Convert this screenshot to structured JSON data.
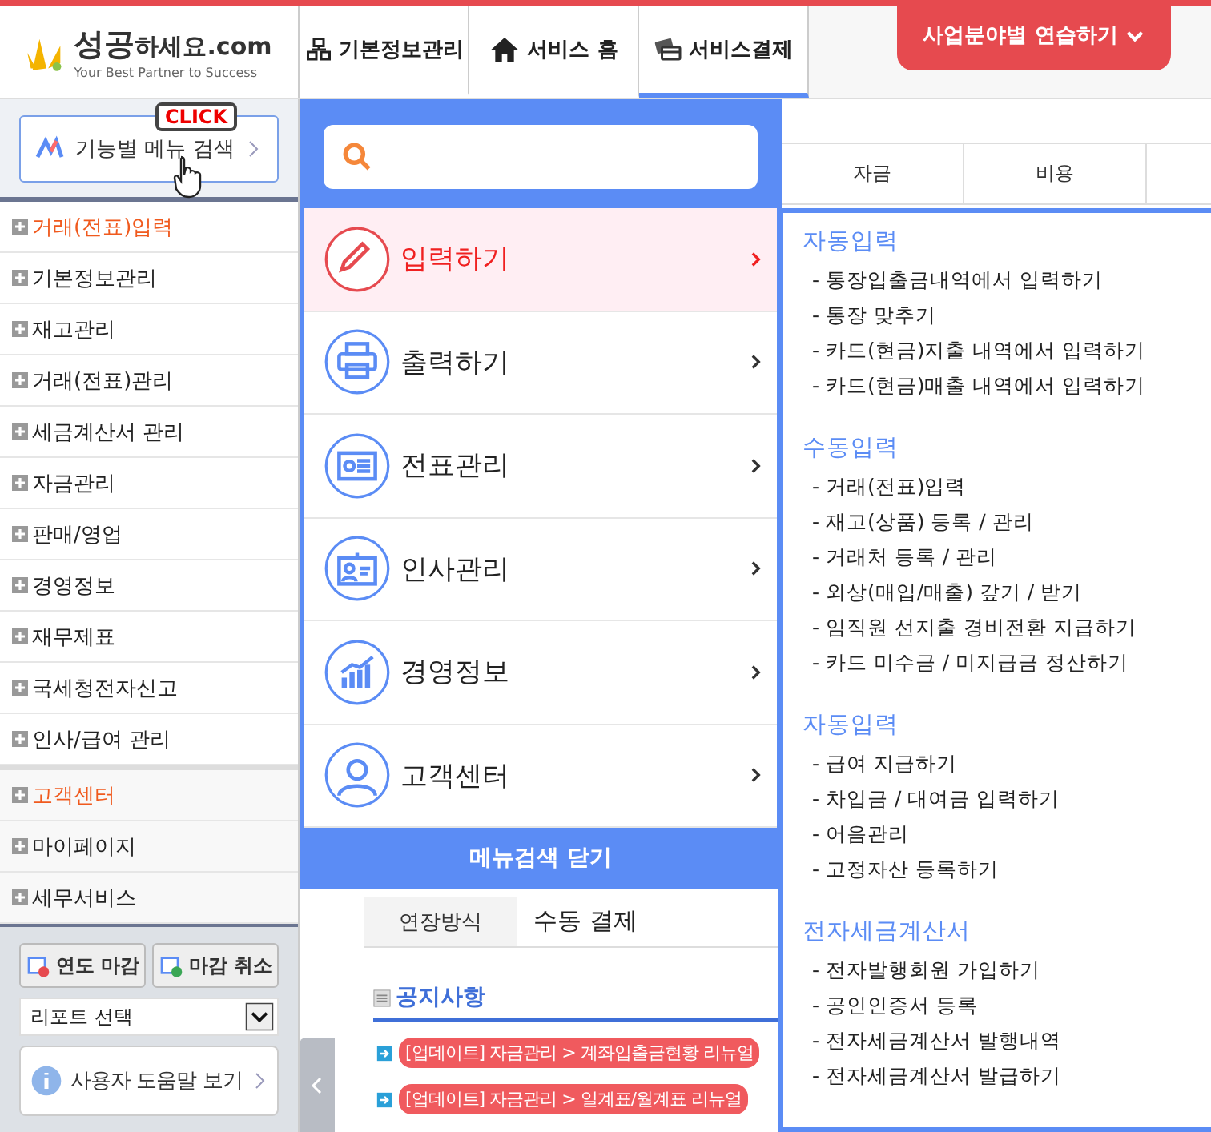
{
  "header": {
    "logo": {
      "brand": "성공",
      "rest": "하세요.com",
      "tagline": "Your Best Partner to Success"
    },
    "nav": [
      {
        "label": "기본정보관리",
        "selected": false
      },
      {
        "label": "서비스 홈",
        "selected": false
      },
      {
        "label": "서비스결제",
        "selected": true
      }
    ],
    "practice_button": {
      "label": "사업분야별 연습하기"
    }
  },
  "sidebar": {
    "search_button": {
      "label": "기능별 메뉴 검색",
      "callout": "CLICK"
    },
    "groups": [
      {
        "items": [
          {
            "label": "거래(전표)입력",
            "highlighted": true
          },
          {
            "label": "기본정보관리",
            "highlighted": false
          },
          {
            "label": "재고관리",
            "highlighted": false
          },
          {
            "label": "거래(전표)관리",
            "highlighted": false
          },
          {
            "label": "세금계산서 관리",
            "highlighted": false
          },
          {
            "label": "자금관리",
            "highlighted": false
          },
          {
            "label": "판매/영업",
            "highlighted": false
          },
          {
            "label": "경영정보",
            "highlighted": false
          },
          {
            "label": "재무제표",
            "highlighted": false
          },
          {
            "label": "국세청전자신고",
            "highlighted": false
          },
          {
            "label": "인사/급여 관리",
            "highlighted": false
          }
        ]
      },
      {
        "items": [
          {
            "label": "고객센터",
            "highlighted": true
          },
          {
            "label": "마이페이지",
            "highlighted": false
          },
          {
            "label": "세무서비스",
            "highlighted": false
          }
        ]
      }
    ],
    "buttons": [
      "연도 마감",
      "마감 취소"
    ],
    "report_select": {
      "value": "리포트 선택"
    },
    "help_button": {
      "label": "사용자 도움말 보기"
    }
  },
  "main": {
    "tabs": [
      "자금",
      "비용"
    ],
    "info_row": {
      "label": "연장방식",
      "value": "수동 결제"
    },
    "notices": {
      "title": "공지사항",
      "items": [
        "[업데이트] 자금관리 > 계좌입출금현황 리뉴얼",
        "[업데이트] 자금관리 > 일계표/월계표 리뉴얼"
      ]
    }
  },
  "menu_search": {
    "items": [
      {
        "label": "입력하기",
        "selected": true
      },
      {
        "label": "출력하기",
        "selected": false
      },
      {
        "label": "전표관리",
        "selected": false
      },
      {
        "label": "인사관리",
        "selected": false
      },
      {
        "label": "경영정보",
        "selected": false
      },
      {
        "label": "고객센터",
        "selected": false
      }
    ],
    "close_button": "메뉴검색 닫기"
  },
  "submenu": {
    "sections": [
      {
        "title": "자동입력",
        "items": [
          "- 통장입출금내역에서 입력하기",
          "- 통장 맞추기",
          "- 카드(현금)지출 내역에서 입력하기",
          "- 카드(현금)매출 내역에서 입력하기"
        ]
      },
      {
        "title": "수동입력",
        "items": [
          "- 거래(전표)입력",
          "- 재고(상품) 등록 / 관리",
          "- 거래처 등록 / 관리",
          "- 외상(매입/매출) 갚기 / 받기",
          "- 임직원 선지출 경비전환 지급하기",
          "- 카드 미수금 / 미지급금 정산하기"
        ]
      },
      {
        "title": "자동입력",
        "items": [
          "- 급여 지급하기",
          "- 차입금 / 대여금 입력하기",
          "- 어음관리",
          "- 고정자산 등록하기"
        ]
      },
      {
        "title": "전자세금계산서",
        "items": [
          "- 전자발행회원 가입하기",
          "- 공인인증서 등록",
          "- 전자세금계산서 발행내역",
          "- 전자세금계산서 발급하기"
        ]
      }
    ]
  }
}
